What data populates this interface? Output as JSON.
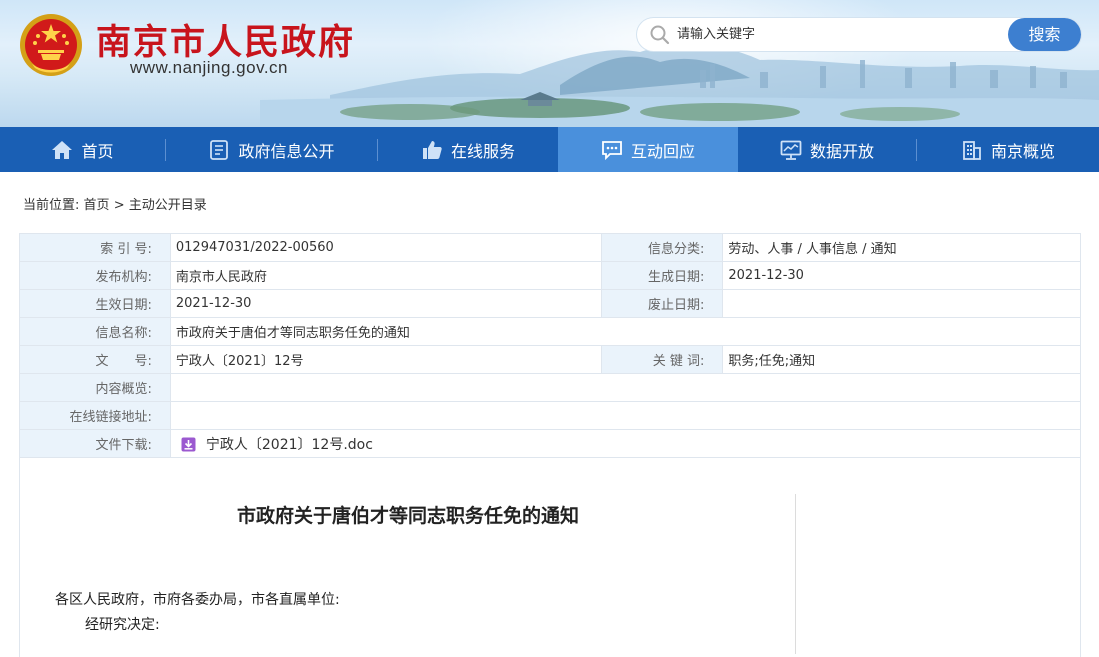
{
  "header": {
    "site_title": "南京市人民政府",
    "site_url": "www.nanjing.gov.cn",
    "search_placeholder": "请输入关键字",
    "search_button": "搜索"
  },
  "nav": {
    "items": [
      {
        "label": "首页",
        "icon": "home-icon"
      },
      {
        "label": "政府信息公开",
        "icon": "document-icon"
      },
      {
        "label": "在线服务",
        "icon": "thumbs-up-icon"
      },
      {
        "label": "互动回应",
        "icon": "chat-icon",
        "active": true
      },
      {
        "label": "数据开放",
        "icon": "monitor-icon"
      },
      {
        "label": "南京概览",
        "icon": "building-icon"
      }
    ]
  },
  "breadcrumb": {
    "prefix": "当前位置:",
    "home": "首页",
    "sep": ">",
    "current": "主动公开目录"
  },
  "meta": {
    "index_label": "索 引 号:",
    "index_value": "012947031/2022-00560",
    "category_label": "信息分类:",
    "category_value": "劳动、人事 / 人事信息 / 通知",
    "publisher_label": "发布机构:",
    "publisher_value": "南京市人民政府",
    "created_label": "生成日期:",
    "created_value": "2021-12-30",
    "effective_label": "生效日期:",
    "effective_value": "2021-12-30",
    "abolished_label": "废止日期:",
    "abolished_value": "",
    "name_label": "信息名称:",
    "name_value": "市政府关于唐伯才等同志职务任免的通知",
    "docno_label": "文　　号:",
    "docno_value": "宁政人〔2021〕12号",
    "keywords_label": "关 键 词:",
    "keywords_value": "职务;任免;通知",
    "summary_label": "内容概览:",
    "summary_value": "",
    "link_label": "在线链接地址:",
    "link_value": "",
    "download_label": "文件下载:",
    "download_value": "宁政人〔2021〕12号.doc"
  },
  "article": {
    "title": "市政府关于唐伯才等同志职务任免的通知",
    "paragraph1": "各区人民政府，市府各委办局，市各直属单位:",
    "paragraph2": "经研究决定:"
  },
  "colors": {
    "nav_bg": "#1a5fb4",
    "nav_active": "#4a90dc",
    "title_red": "#c8141c",
    "search_button": "#3d7fd0",
    "label_bg": "#eaf3fb"
  }
}
